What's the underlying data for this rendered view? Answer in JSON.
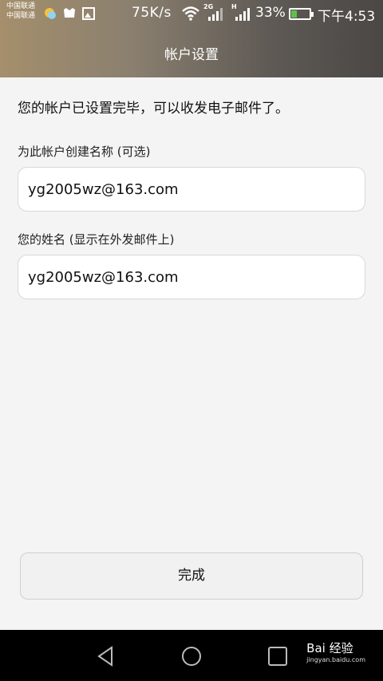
{
  "status_bar": {
    "carrier_1": "中国联通",
    "carrier_2": "中国联通",
    "net_speed": "75K/s",
    "net_2g": "2G",
    "net_h": "H",
    "battery_percent": "33%",
    "time": "下午4:53",
    "battery_level": 0.33,
    "icons": [
      "weather-icon",
      "app-notification-icon",
      "image-icon",
      "wifi-icon",
      "signal-icon",
      "battery-icon"
    ]
  },
  "header": {
    "title": "帐户设置"
  },
  "main": {
    "intro": "您的帐户已设置完毕，可以收发电子邮件了。",
    "account_name_label": "为此帐户创建名称 (可选)",
    "account_name_value": "yg2005wz@163.com",
    "your_name_label": "您的姓名 (显示在外发邮件上)",
    "your_name_value": "yg2005wz@163.com",
    "done_label": "完成"
  },
  "nav_bar": {
    "icons": [
      "back-icon",
      "home-icon",
      "recents-icon"
    ]
  },
  "watermark": {
    "brand": "Bai 经验",
    "url": "jingyan.baidu.com"
  }
}
